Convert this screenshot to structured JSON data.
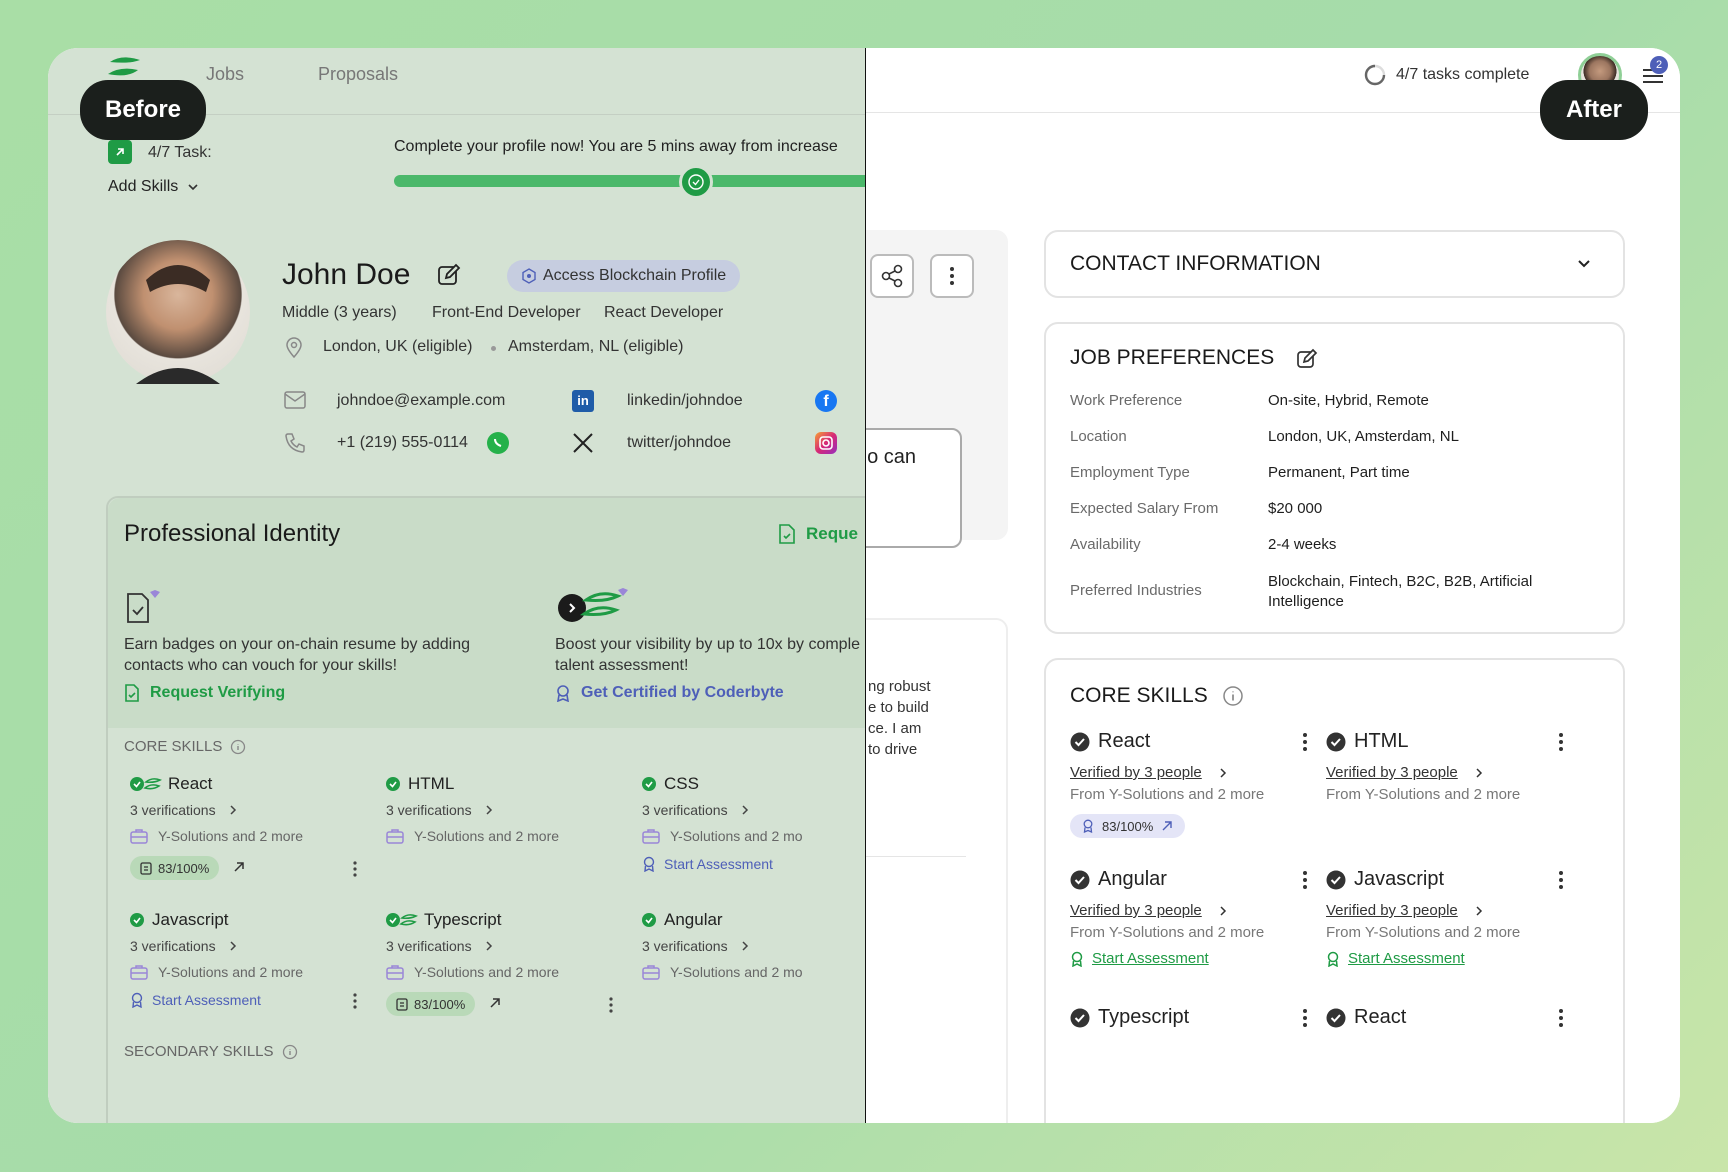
{
  "labels": {
    "before": "Before",
    "after": "After"
  },
  "before": {
    "nav": {
      "jobs": "Jobs",
      "proposals": "Proposals"
    },
    "task": {
      "count": "4/7 Task:",
      "current": "Add Skills",
      "banner": "Complete your profile now! You are 5 mins away from increase"
    },
    "profile": {
      "name": "John Doe",
      "blockchain_button": "Access Blockchain Profile",
      "level": "Middle (3 years)",
      "roles": [
        "Front-End Developer",
        "React Developer"
      ],
      "locations": [
        "London, UK (eligible)",
        "Amsterdam, NL (eligible)"
      ],
      "email": "johndoe@example.com",
      "phone": "+1 (219) 555-0114",
      "linkedin": "linkedin/johndoe",
      "twitter": "twitter/johndoe"
    },
    "identity": {
      "title": "Professional Identity",
      "request_link": "Reque",
      "promo1": {
        "text": "Earn badges on your on-chain resume by adding contacts who can vouch for your skills!",
        "link": "Request Verifying"
      },
      "promo2": {
        "text": "Boost your visibility by up to 10x by comple talent assessment!",
        "link": "Get Certified by Coderbyte"
      }
    },
    "core_skills_title": "CORE SKILLS",
    "secondary_skills_title": "SECONDARY SKILLS",
    "skills": [
      {
        "name": "React",
        "verifications": "3 verifications",
        "company": "Y-Solutions and 2 more",
        "score": "83/100%"
      },
      {
        "name": "HTML",
        "verifications": "3 verifications",
        "company": "Y-Solutions and 2 more"
      },
      {
        "name": "CSS",
        "verifications": "3 verifications",
        "company": "Y-Solutions and 2 mo",
        "action": "Start Assessment"
      },
      {
        "name": "Javascript",
        "verifications": "3 verifications",
        "company": "Y-Solutions and 2 more",
        "action": "Start Assessment"
      },
      {
        "name": "Typescript",
        "verifications": "3 verifications",
        "company": "Y-Solutions and 2 more",
        "score": "83/100%"
      },
      {
        "name": "Angular",
        "verifications": "3 verifications",
        "company": "Y-Solutions and 2 mo"
      }
    ]
  },
  "after": {
    "tasks": "4/7 tasks complete",
    "notif_count": "2",
    "middle_text": "vho can",
    "about_lines": [
      "ng robust",
      "e to build",
      "ce. I am",
      "to drive"
    ],
    "contact_title": "CONTACT INFORMATION",
    "job_prefs": {
      "title": "JOB PREFERENCES",
      "rows": [
        {
          "label": "Work Preference",
          "value": "On-site, Hybrid, Remote"
        },
        {
          "label": "Location",
          "value": "London, UK, Amsterdam, NL"
        },
        {
          "label": "Employment Type",
          "value": "Permanent, Part time"
        },
        {
          "label": "Expected Salary From",
          "value": "$20 000"
        },
        {
          "label": "Availability",
          "value": "2-4 weeks"
        },
        {
          "label": "Preferred Industries",
          "value": "Blockchain, Fintech, B2C, B2B, Artificial Intelligence"
        }
      ]
    },
    "core_skills_title": "CORE SKILLS",
    "skills": [
      {
        "name": "React",
        "verified": "Verified by 3 people",
        "from": "From Y-Solutions and 2 more",
        "score": "83/100%"
      },
      {
        "name": "HTML",
        "verified": "Verified by 3 people",
        "from": "From Y-Solutions and 2 more"
      },
      {
        "name": "Angular",
        "verified": "Verified by 3 people",
        "from": "From Y-Solutions and 2 more",
        "action": "Start Assessment"
      },
      {
        "name": "Javascript",
        "verified": "Verified by 3 people",
        "from": "From Y-Solutions and 2 more",
        "action": "Start Assessment"
      },
      {
        "name": "Typescript"
      },
      {
        "name": "React"
      }
    ]
  },
  "colors": {
    "green": "#1f9b45",
    "purple": "#4e5fb8",
    "dark": "#1b1f1c"
  }
}
